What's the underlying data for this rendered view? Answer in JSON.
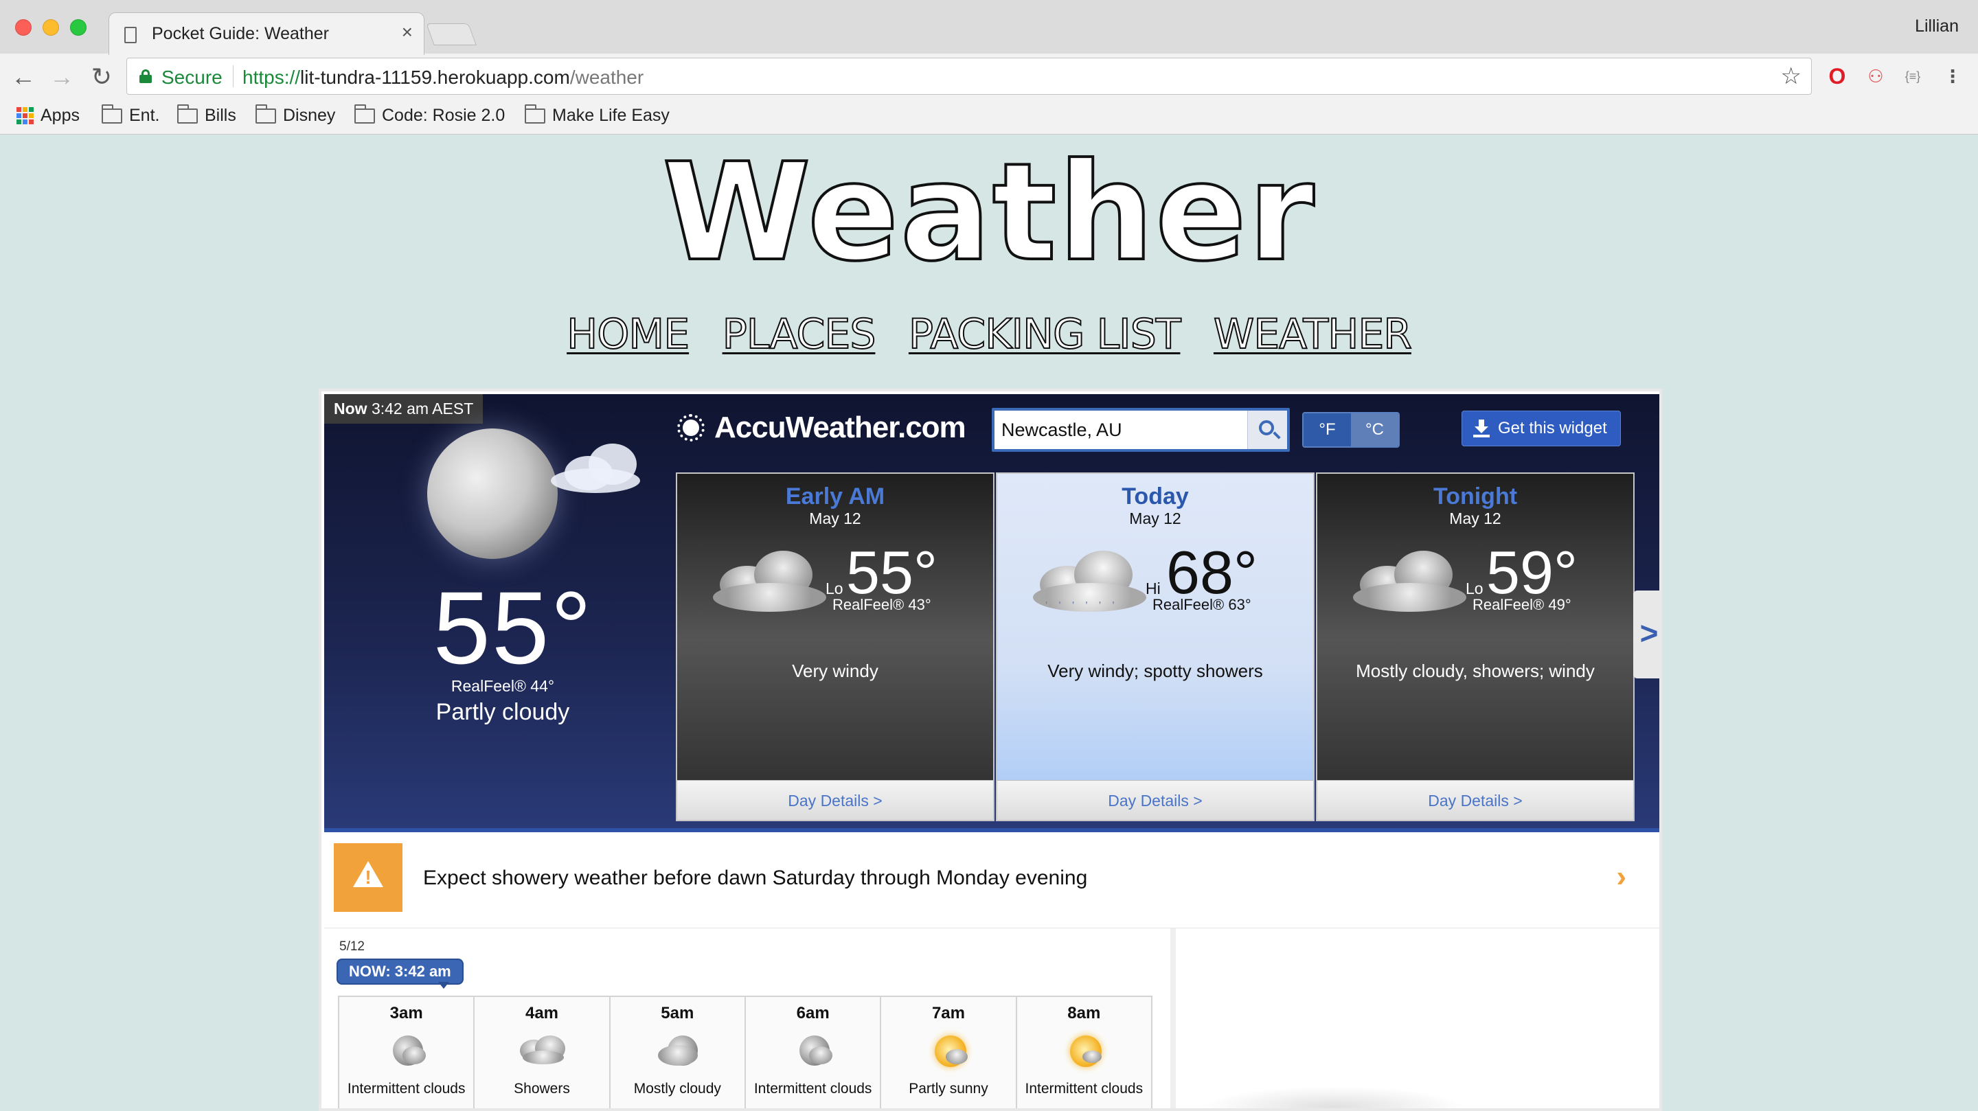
{
  "browser": {
    "tab_title": "Pocket Guide: Weather",
    "tab_close": "×",
    "profile_name": "Lillian",
    "secure_label": "Secure",
    "url_scheme": "https://",
    "url_host": "lit-tundra-11159.herokuapp.com",
    "url_path": "/weather",
    "nav": {
      "back": "←",
      "forward": "→",
      "reload": "↻"
    },
    "star": "☆",
    "extensions": [
      "opera-icon",
      "extension-icon",
      "json-icon",
      "menu-icon"
    ],
    "ext_labels": {
      "opera": "O",
      "ext2": "⚇",
      "ext3": "{≡}",
      "menu": "⋮"
    },
    "bookmarks": [
      "Apps",
      "Ent.",
      "Bills",
      "Disney",
      "Code: Rosie 2.0",
      "Make Life Easy"
    ]
  },
  "site": {
    "logo": "Weather",
    "nav": [
      "HOME",
      "PLACES",
      "PACKING LIST",
      "WEATHER"
    ]
  },
  "widget": {
    "now_label": "Now",
    "now_time": "3:42 am AEST",
    "brand": "AccuWeather.com",
    "search_value": "Newcastle, AU",
    "unit_f": "°F",
    "unit_c": "°C",
    "get_widget": "Get this widget",
    "current": {
      "temp": "55°",
      "realfeel": "RealFeel® 44°",
      "condition": "Partly cloudy"
    },
    "forecasts": [
      {
        "title": "Early AM",
        "date": "May 12",
        "lohi": "Lo",
        "temp": "55°",
        "realfeel": "RealFeel® 43°",
        "desc": "Very windy",
        "details": "Day Details >",
        "theme": "dark"
      },
      {
        "title": "Today",
        "date": "May 12",
        "lohi": "Hi",
        "temp": "68°",
        "realfeel": "RealFeel® 63°",
        "desc": "Very windy; spotty showers",
        "details": "Day Details >",
        "theme": "light"
      },
      {
        "title": "Tonight",
        "date": "May 12",
        "lohi": "Lo",
        "temp": "59°",
        "realfeel": "RealFeel® 49°",
        "desc": "Mostly cloudy, showers; windy",
        "details": "Day Details >",
        "theme": "dark"
      }
    ],
    "next_arrow": ">",
    "alert": {
      "icon_glyph": "!",
      "text": "Expect showery weather before dawn Saturday through Monday evening",
      "chevron": "›"
    },
    "hourly": {
      "date": "5/12",
      "now_pill": "NOW: 3:42 am",
      "hours": [
        {
          "time": "3am",
          "condition": "Intermittent clouds",
          "icon": "moon-cloud-icon"
        },
        {
          "time": "4am",
          "condition": "Showers",
          "icon": "showers-icon"
        },
        {
          "time": "5am",
          "condition": "Mostly cloudy",
          "icon": "mostly-cloudy-night-icon"
        },
        {
          "time": "6am",
          "condition": "Intermittent clouds",
          "icon": "moon-cloud-icon"
        },
        {
          "time": "7am",
          "condition": "Partly sunny",
          "icon": "partly-sunny-icon"
        },
        {
          "time": "8am",
          "condition": "Intermittent clouds",
          "icon": "sun-cloud-icon"
        }
      ]
    }
  },
  "colors": {
    "page_bg": "#d5e6e5",
    "accent_blue": "#3b6ab8",
    "alert_orange": "#f2a23a",
    "secure_green": "#1a8a3a"
  }
}
